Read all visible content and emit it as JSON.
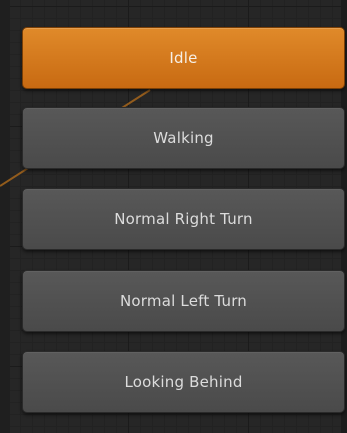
{
  "animator": {
    "states": [
      {
        "label": "Idle",
        "state": "default-selected"
      },
      {
        "label": "Walking",
        "state": "normal"
      },
      {
        "label": "Normal Right Turn",
        "state": "normal"
      },
      {
        "label": "Normal Left Turn",
        "state": "normal"
      },
      {
        "label": "Looking Behind",
        "state": "normal"
      }
    ],
    "colors": {
      "selected_state": "#d27a1c",
      "normal_state": "#525252",
      "background": "#262626",
      "transition_line": "#b86f1a"
    }
  }
}
